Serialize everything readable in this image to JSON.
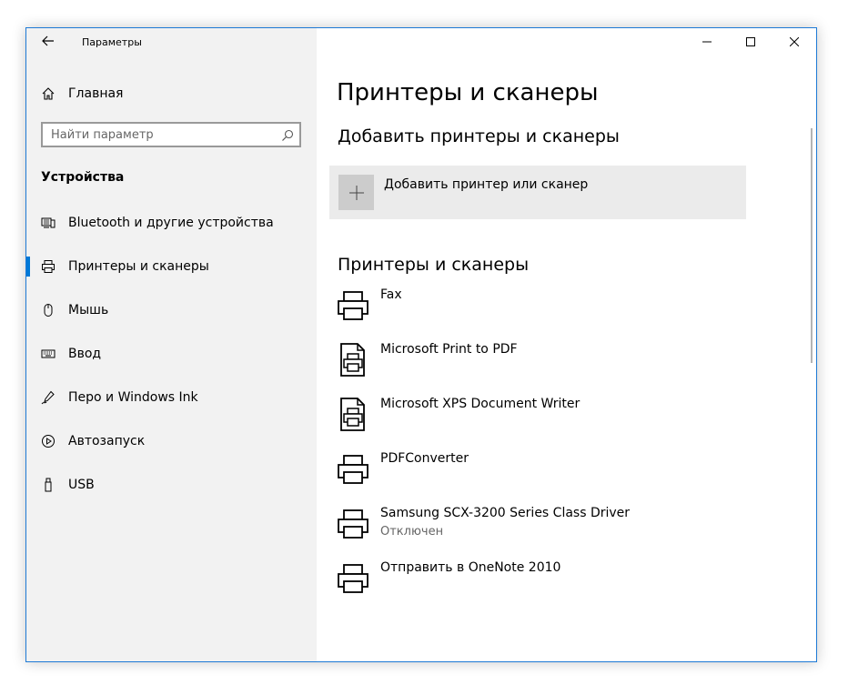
{
  "window": {
    "title": "Параметры",
    "back_icon": "arrow-left-icon",
    "controls": {
      "minimize_icon": "minimize-icon",
      "maximize_icon": "maximize-icon",
      "close_icon": "close-icon"
    }
  },
  "sidebar": {
    "home": {
      "label": "Главная",
      "icon": "home-icon"
    },
    "search": {
      "placeholder": "Найти параметр",
      "value": "",
      "icon": "search-icon"
    },
    "section": "Устройства",
    "items": [
      {
        "label": "Bluetooth и другие устройства",
        "icon": "devices-icon"
      },
      {
        "label": "Принтеры и сканеры",
        "icon": "printer-icon",
        "active": true
      },
      {
        "label": "Мышь",
        "icon": "mouse-icon"
      },
      {
        "label": "Ввод",
        "icon": "keyboard-icon"
      },
      {
        "label": "Перо и Windows Ink",
        "icon": "pen-icon"
      },
      {
        "label": "Автозапуск",
        "icon": "autoplay-icon"
      },
      {
        "label": "USB",
        "icon": "usb-icon"
      }
    ]
  },
  "main": {
    "title": "Принтеры и сканеры",
    "add_section": {
      "heading": "Добавить принтеры и сканеры",
      "button_label": "Добавить принтер или сканер",
      "icon": "plus-icon"
    },
    "list_heading": "Принтеры и сканеры",
    "printers": [
      {
        "name": "Fax",
        "status": "",
        "icon": "printer-icon"
      },
      {
        "name": "Microsoft Print to PDF",
        "status": "",
        "icon": "printer-document-icon"
      },
      {
        "name": "Microsoft XPS Document Writer",
        "status": "",
        "icon": "printer-document-icon"
      },
      {
        "name": "PDFConverter",
        "status": "",
        "icon": "printer-icon"
      },
      {
        "name": "Samsung SCX-3200 Series Class Driver",
        "status": "Отключен",
        "icon": "printer-icon"
      },
      {
        "name": "Отправить в OneNote 2010",
        "status": "",
        "icon": "printer-icon"
      }
    ]
  },
  "colors": {
    "accent": "#0078d7",
    "sidebar_bg": "#f2f2f2",
    "tile_bg": "#ebebeb",
    "window_border": "#1e7ad6"
  }
}
